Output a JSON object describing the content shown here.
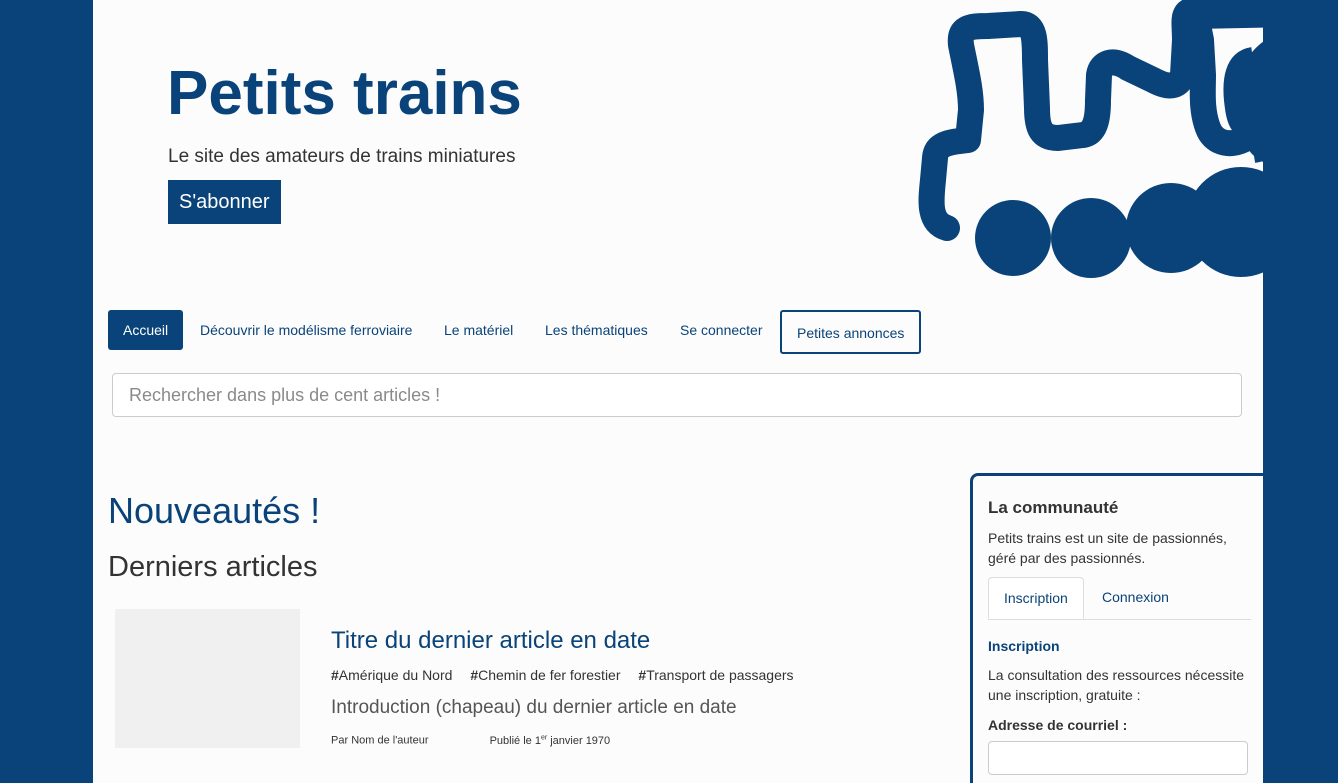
{
  "header": {
    "site_title": "Petits trains",
    "tagline": "Le site des amateurs de trains miniatures",
    "subscribe_label": "S'abonner",
    "logo_icon": "train-icon"
  },
  "nav": {
    "items": [
      {
        "label": "Accueil"
      },
      {
        "label": "Découvrir le modélisme ferroviaire"
      },
      {
        "label": "Le matériel"
      },
      {
        "label": "Les thématiques"
      },
      {
        "label": "Se connecter"
      },
      {
        "label": "Petites annonces"
      }
    ]
  },
  "search": {
    "placeholder": "Rechercher dans plus de cent articles !",
    "value": ""
  },
  "main": {
    "news_title": "Nouveautés !",
    "articles_title": "Derniers articles",
    "article": {
      "title": "Titre du dernier article en date",
      "tags": [
        "Amérique du Nord",
        "Chemin de fer forestier",
        "Transport de passagers"
      ],
      "tag_prefix": "#",
      "intro": "Introduction (chapeau) du dernier article en date",
      "author_prefix": "Par",
      "author": "Nom de l'auteur",
      "date_prefix": "Publié le 1",
      "date_sup": "er",
      "date_rest": " janvier 1970"
    }
  },
  "sidebar": {
    "title": "La communauté",
    "description": "Petits trains est un site de passionnés, géré par des passionnés.",
    "tabs": [
      {
        "label": "Inscription"
      },
      {
        "label": "Connexion"
      }
    ],
    "section_heading": "Inscription",
    "section_text": "La consultation des ressources nécessite une inscription, gratuite :",
    "email_label": "Adresse de courriel :",
    "email_value": ""
  },
  "colors": {
    "brand": "#0a4379",
    "background": "#fcfcfc"
  }
}
